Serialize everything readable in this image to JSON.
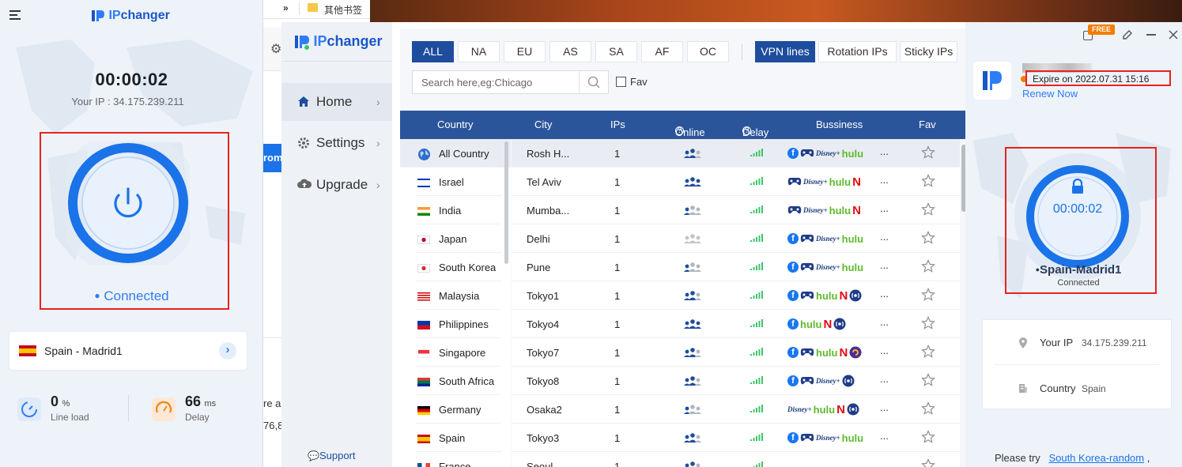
{
  "left_app": {
    "logo_prefix": "IP",
    "logo_suffix": "changer",
    "timer": "00:00:02",
    "your_ip": "Your IP : 34.175.239.211",
    "status": "Connected",
    "location": "Spain - Madrid1",
    "stats": {
      "line_load_value": "0",
      "line_load_unit": "%",
      "line_load_label": "Line load",
      "delay_value": "66",
      "delay_unit": "ms",
      "delay_label": "Delay"
    }
  },
  "browser": {
    "overflow_chevron": "»",
    "bookmark_folder": "其他书签",
    "fragments": [
      "rom",
      "re ar",
      "76,8"
    ]
  },
  "main_app": {
    "logo_prefix": "IP",
    "logo_suffix": "changer",
    "sidebar": {
      "items": [
        {
          "label": "Home",
          "icon": "home-icon"
        },
        {
          "label": "Settings",
          "icon": "gear-icon"
        },
        {
          "label": "Upgrade",
          "icon": "cloud-upload-icon"
        }
      ],
      "support": "Support"
    },
    "region_tabs": [
      "ALL",
      "NA",
      "EU",
      "AS",
      "SA",
      "AF",
      "OC"
    ],
    "active_region": "ALL",
    "line_tabs": [
      "VPN lines",
      "Rotation IPs",
      "Sticky IPs"
    ],
    "active_line": "VPN lines",
    "search": {
      "placeholder": "Search here,eg:Chicago"
    },
    "fav_filter": "Fav",
    "columns": [
      "Country",
      "City",
      "IPs",
      "Online",
      "Delay",
      "Bussiness",
      "Fav"
    ],
    "countries": [
      "All Country",
      "Israel",
      "India",
      "Japan",
      "South Korea",
      "Malaysia",
      "Philippines",
      "Singapore",
      "South Africa",
      "Germany",
      "Spain",
      "France"
    ],
    "rows": [
      {
        "city": "Rosh H...",
        "ips": "1",
        "online": "medium",
        "badges": [
          "fb",
          "game",
          "disney",
          "hulu"
        ],
        "more": "..."
      },
      {
        "city": "Tel Aviv",
        "ips": "1",
        "online": "high",
        "badges": [
          "game",
          "disney",
          "hulu",
          "netflix"
        ],
        "more": "..."
      },
      {
        "city": "Mumba...",
        "ips": "1",
        "online": "low",
        "badges": [
          "game",
          "disney",
          "hulu",
          "netflix"
        ],
        "more": "..."
      },
      {
        "city": "Delhi",
        "ips": "1",
        "online": "none",
        "badges": [
          "fb",
          "game",
          "disney",
          "hulu"
        ],
        "more": "..."
      },
      {
        "city": "Pune",
        "ips": "1",
        "online": "low",
        "badges": [
          "fb",
          "game",
          "disney",
          "hulu"
        ],
        "more": "..."
      },
      {
        "city": "Tokyo1",
        "ips": "1",
        "online": "medium",
        "badges": [
          "fb",
          "game",
          "hulu",
          "netflix",
          "radio"
        ],
        "more": "..."
      },
      {
        "city": "Tokyo4",
        "ips": "1",
        "online": "high",
        "badges": [
          "fb",
          "hulu",
          "netflix",
          "radio"
        ],
        "more": "..."
      },
      {
        "city": "Tokyo7",
        "ips": "1",
        "online": "medium",
        "badges": [
          "fb",
          "game",
          "hulu",
          "netflix",
          "purple"
        ],
        "more": "..."
      },
      {
        "city": "Tokyo8",
        "ips": "1",
        "online": "medium",
        "badges": [
          "fb",
          "game",
          "disney",
          "radio"
        ],
        "more": "..."
      },
      {
        "city": "Osaka2",
        "ips": "1",
        "online": "low",
        "badges": [
          "disney",
          "hulu",
          "netflix",
          "radio"
        ],
        "more": "..."
      },
      {
        "city": "Tokyo3",
        "ips": "1",
        "online": "medium",
        "badges": [
          "fb",
          "game",
          "disney",
          "hulu"
        ],
        "more": "..."
      },
      {
        "city": "Seoul",
        "ips": "1",
        "online": "medium",
        "badges": [],
        "more": ""
      }
    ],
    "badge_text": {
      "fb": "f",
      "disney": "Disney+",
      "hulu": "hulu",
      "netflix": "N"
    },
    "colors": {
      "header": "#2b559b",
      "tab_active": "#1f4d9e",
      "accent": "#1a73e8",
      "red_box": "#e8221f"
    }
  },
  "right_app": {
    "free_badge": "FREE",
    "expire": "Expire on 2022.07.31 15:16",
    "renew": "Renew Now",
    "timer": "00:00:02",
    "location": "Spain-Madrid1",
    "status": "Connected",
    "your_ip_label": "Your IP",
    "your_ip_value": "34.175.239.211",
    "country_label": "Country",
    "country_value": "Spain",
    "please_try": "Please try",
    "suggestion": "South Korea-random",
    "suggestion_suffix": ","
  }
}
